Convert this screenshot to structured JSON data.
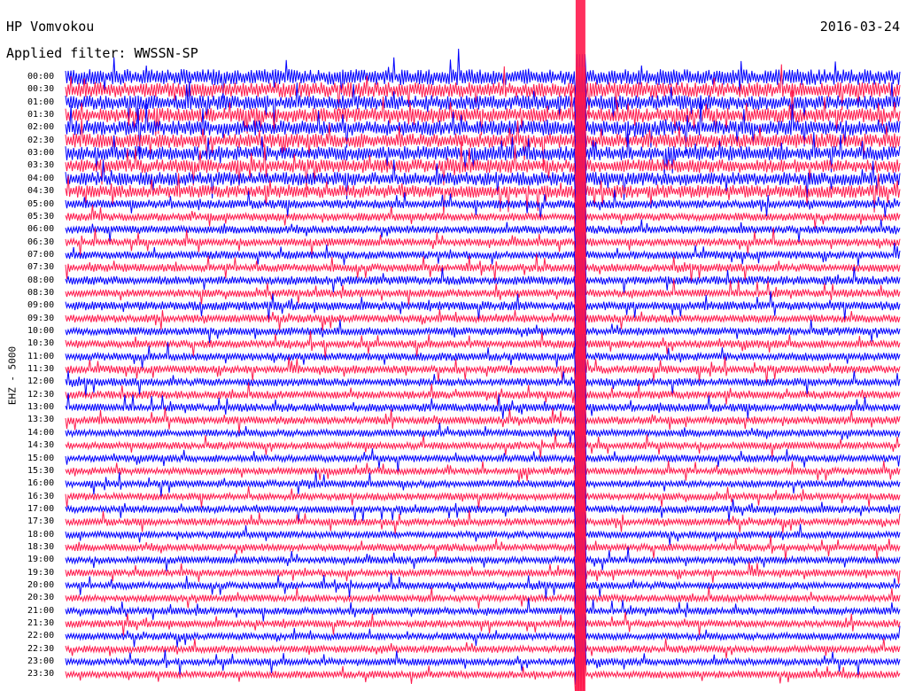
{
  "header": {
    "station": "HP Vomvokou",
    "date": "2016-03-24",
    "filter_text": "Applied filter: WWSSN-SP"
  },
  "chart_data": {
    "type": "line",
    "title": "HP Vomvokou",
    "subtitle": "Applied filter: WWSSN-SP",
    "date": "2016-03-24",
    "ylabel": "EHZ - 5000",
    "row_labels": [
      "00:00",
      "00:30",
      "01:00",
      "01:30",
      "02:00",
      "02:30",
      "03:00",
      "03:30",
      "04:00",
      "04:30",
      "05:00",
      "05:30",
      "06:00",
      "06:30",
      "07:00",
      "07:30",
      "08:00",
      "08:30",
      "09:00",
      "09:30",
      "10:00",
      "10:30",
      "11:00",
      "11:30",
      "12:00",
      "12:30",
      "13:00",
      "13:30",
      "14:00",
      "14:30",
      "15:00",
      "15:30",
      "16:00",
      "16:30",
      "17:00",
      "17:30",
      "18:00",
      "18:30",
      "19:00",
      "19:30",
      "20:00",
      "20:30",
      "21:00",
      "21:30",
      "22:00",
      "22:30",
      "23:00",
      "23:30"
    ],
    "series_colors": [
      "#0000ff",
      "#ff1a4d"
    ],
    "row_amplitude": [
      1.0,
      0.95,
      0.9,
      0.9,
      0.95,
      0.9,
      0.9,
      0.85,
      0.85,
      0.8,
      0.55,
      0.5,
      0.5,
      0.5,
      0.5,
      0.5,
      0.55,
      0.5,
      0.55,
      0.5,
      0.5,
      0.5,
      0.5,
      0.5,
      0.5,
      0.5,
      0.5,
      0.5,
      0.45,
      0.45,
      0.45,
      0.45,
      0.45,
      0.45,
      0.45,
      0.45,
      0.45,
      0.45,
      0.45,
      0.45,
      0.45,
      0.45,
      0.45,
      0.45,
      0.45,
      0.45,
      0.45,
      0.45
    ],
    "event_minute": 18.5,
    "grid": false,
    "legend": "none"
  }
}
